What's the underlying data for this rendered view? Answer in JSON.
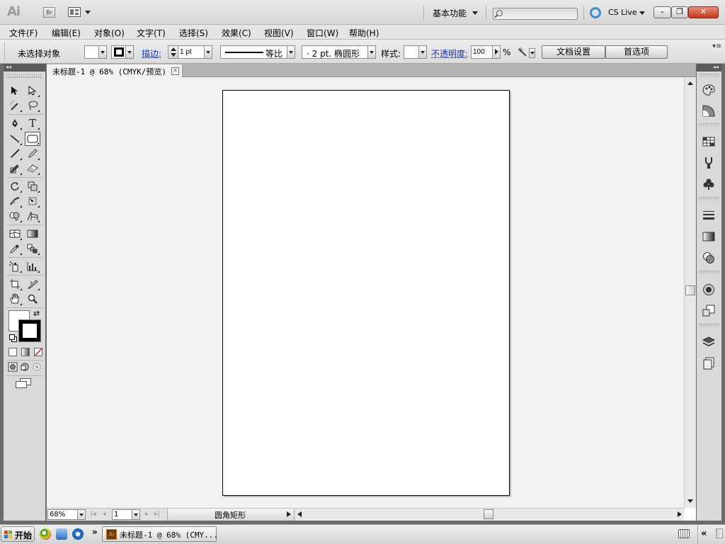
{
  "app": {
    "logo": "Ai",
    "bridge_label": "Br",
    "workspace": "基本功能",
    "search_placeholder": "",
    "cslive": "CS Live",
    "win_min": "–",
    "win_max": "❐",
    "win_close": "✕"
  },
  "menu": [
    "文件(F)",
    "编辑(E)",
    "对象(O)",
    "文字(T)",
    "选择(S)",
    "效果(C)",
    "视图(V)",
    "窗口(W)",
    "帮助(H)"
  ],
  "control": {
    "selection": "未选择对象",
    "stroke_label": "描边:",
    "stroke_weight": "1 pt",
    "profile": "等比",
    "brush": "·  2 pt. 椭圆形",
    "style_label": "样式:",
    "opacity_label": "不透明度:",
    "opacity": "100",
    "percent": "%",
    "doc_setup": "文档设置",
    "prefs": "首选项",
    "panel_menu": "▾≡"
  },
  "tools_panel": {
    "collapse": "◂◂"
  },
  "document": {
    "tab_title": "未标题-1 @ 68% (CMYK/预览)",
    "tab_close": "×",
    "zoom": "68%",
    "page": "1",
    "status": "圆角矩形"
  },
  "dock": {
    "expand": "◂◂"
  },
  "taskbar": {
    "start": "开始",
    "more": "»",
    "item": "未标题-1 @ 68% (CMY...",
    "item_icon": "Ai",
    "tray_more": "«"
  },
  "colors": {
    "accent_link": "#1733c8",
    "cslive_ring": "#3b8fd0",
    "close_red": "#c3391c"
  }
}
